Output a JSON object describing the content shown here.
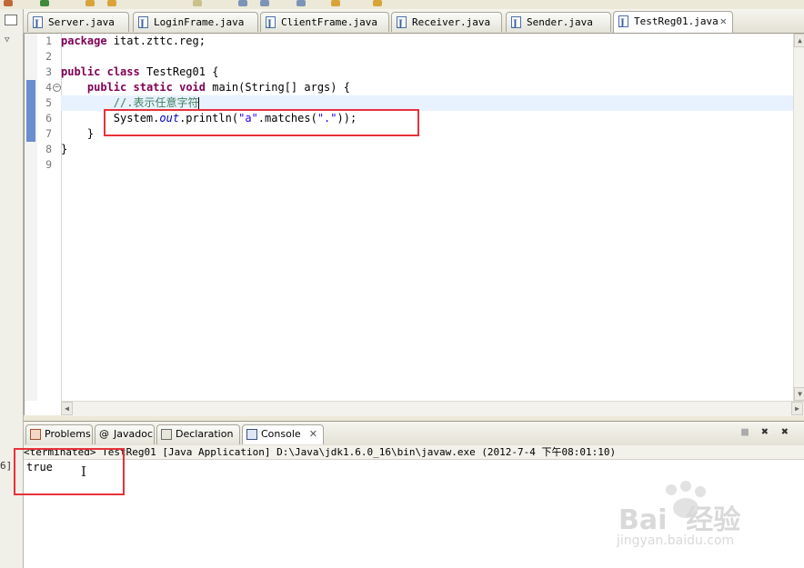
{
  "editor": {
    "tabs": [
      {
        "label": "Server.java"
      },
      {
        "label": "LoginFrame.java"
      },
      {
        "label": "ClientFrame.java"
      },
      {
        "label": "Receiver.java"
      },
      {
        "label": "Sender.java"
      },
      {
        "label": "TestReg01.java",
        "active": true
      }
    ],
    "line_numbers": [
      "1",
      "2",
      "3",
      "4",
      "5",
      "6",
      "7",
      "8",
      "9"
    ],
    "code": {
      "l1_kw": "package",
      "l1_rest": " itat.zttc.reg;",
      "l3_kw1": "public",
      "l3_kw2": "class",
      "l3_rest": " TestReg01 {",
      "l4_indent": "    ",
      "l4_kw1": "public",
      "l4_kw2": "static",
      "l4_kw3": "void",
      "l4_rest": " main(String[] args) {",
      "l5_comment": "        //.表示任意字符",
      "l6_pre": "        System.",
      "l6_out": "out",
      "l6_mid": ".println(",
      "l6_str1": "\"a\"",
      "l6_mid2": ".matches(",
      "l6_str2": "\".\"",
      "l6_end": "));",
      "l7": "    }",
      "l8": "}"
    }
  },
  "bottom_panel": {
    "tabs": [
      {
        "label": "Problems"
      },
      {
        "label": "Javadoc"
      },
      {
        "label": "Declaration"
      },
      {
        "label": "Console",
        "active": true
      }
    ],
    "console_header": "<terminated> TestReg01 [Java Application] D:\\Java\\jdk1.6.0_16\\bin\\javaw.exe (2012-7-4 下午08:01:10)",
    "console_output": "true"
  },
  "left_gutter_marker": "6]",
  "watermark": {
    "brand": "Bai  经验",
    "url": "jingyan.baidu.com"
  },
  "colors": {
    "keyword": "#7f0055",
    "comment": "#3f7f5f",
    "string": "#2a00ff",
    "field": "#0000c0",
    "annotation_box": "#e8323a",
    "current_line": "#e8f2fe"
  }
}
